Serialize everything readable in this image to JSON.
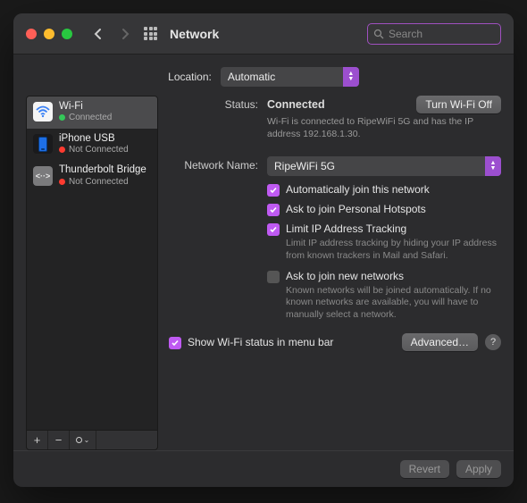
{
  "header": {
    "title": "Network",
    "search_placeholder": "Search"
  },
  "location": {
    "label": "Location:",
    "value": "Automatic"
  },
  "sidebar": {
    "items": [
      {
        "name": "Wi‑Fi",
        "status": "Connected",
        "connected": true,
        "icon": "wifi"
      },
      {
        "name": "iPhone USB",
        "status": "Not Connected",
        "connected": false,
        "icon": "phone"
      },
      {
        "name": "Thunderbolt Bridge",
        "status": "Not Connected",
        "connected": false,
        "icon": "thunderbolt"
      }
    ]
  },
  "detail": {
    "status_label": "Status:",
    "status_value": "Connected",
    "wifi_off_btn": "Turn Wi‑Fi Off",
    "status_help_prefix": "Wi‑Fi is connected to ",
    "status_help_ssid": "RipeWiFi 5G",
    "status_help_mid": " and has the IP address ",
    "status_help_ip": "192.168.1.30",
    "status_help_suffix": ".",
    "netname_label": "Network Name:",
    "netname_value": "RipeWiFi 5G",
    "checkboxes": {
      "auto_join": {
        "label": "Automatically join this network",
        "checked": true
      },
      "ask_hotspot": {
        "label": "Ask to join Personal Hotspots",
        "checked": true
      },
      "limit_ip": {
        "label": "Limit IP Address Tracking",
        "checked": true,
        "help": "Limit IP address tracking by hiding your IP address from known trackers in Mail and Safari."
      },
      "ask_new": {
        "label": "Ask to join new networks",
        "checked": false,
        "help": "Known networks will be joined automatically. If no known networks are available, you will have to manually select a network."
      }
    },
    "show_menubar": {
      "label": "Show Wi‑Fi status in menu bar",
      "checked": true
    },
    "advanced_btn": "Advanced…",
    "help_btn": "?"
  },
  "footer": {
    "revert": "Revert",
    "apply": "Apply"
  }
}
